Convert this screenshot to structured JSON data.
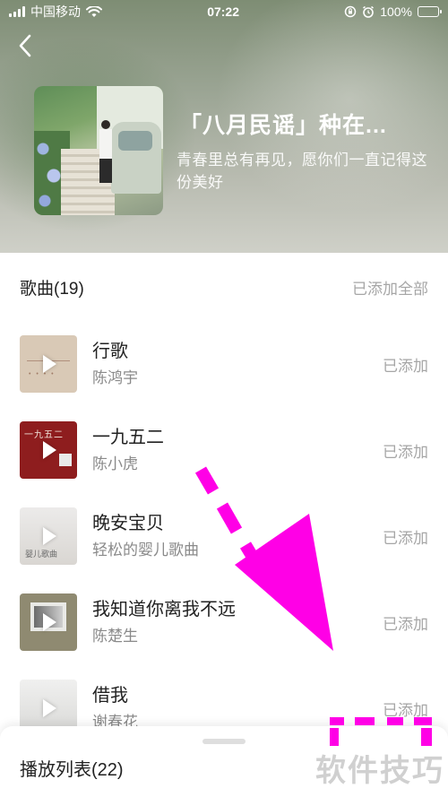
{
  "status_bar": {
    "carrier": "中国移动",
    "time": "07:22",
    "battery": "100%",
    "icons": [
      "signal-icon",
      "wifi-icon",
      "orientation-lock-icon",
      "alarm-icon",
      "battery-icon"
    ]
  },
  "album": {
    "title": "「八月民谣」种在...",
    "description": "青春里总有再见，愿你们一直记得这份美好"
  },
  "songs_header": {
    "title": "歌曲(19)",
    "add_all": "已添加全部"
  },
  "songs": [
    {
      "name": "行歌",
      "artist": "陈鸿宇",
      "status": "已添加"
    },
    {
      "name": "一九五二",
      "artist": "陈小虎",
      "status": "已添加",
      "cover_text": "一九五二"
    },
    {
      "name": "晚安宝贝",
      "artist": "轻松的婴儿歌曲",
      "status": "已添加",
      "cover_text": "婴儿歌曲"
    },
    {
      "name": "我知道你离我不远",
      "artist": "陈楚生",
      "status": "已添加"
    },
    {
      "name": "借我",
      "artist": "谢春花",
      "status": "已添加"
    }
  ],
  "playlist": {
    "label": "播放列表(22)"
  },
  "watermark": "软件技巧",
  "colors": {
    "annotation_arrow": "#ff00e6",
    "muted_text": "#a6a6a6"
  }
}
